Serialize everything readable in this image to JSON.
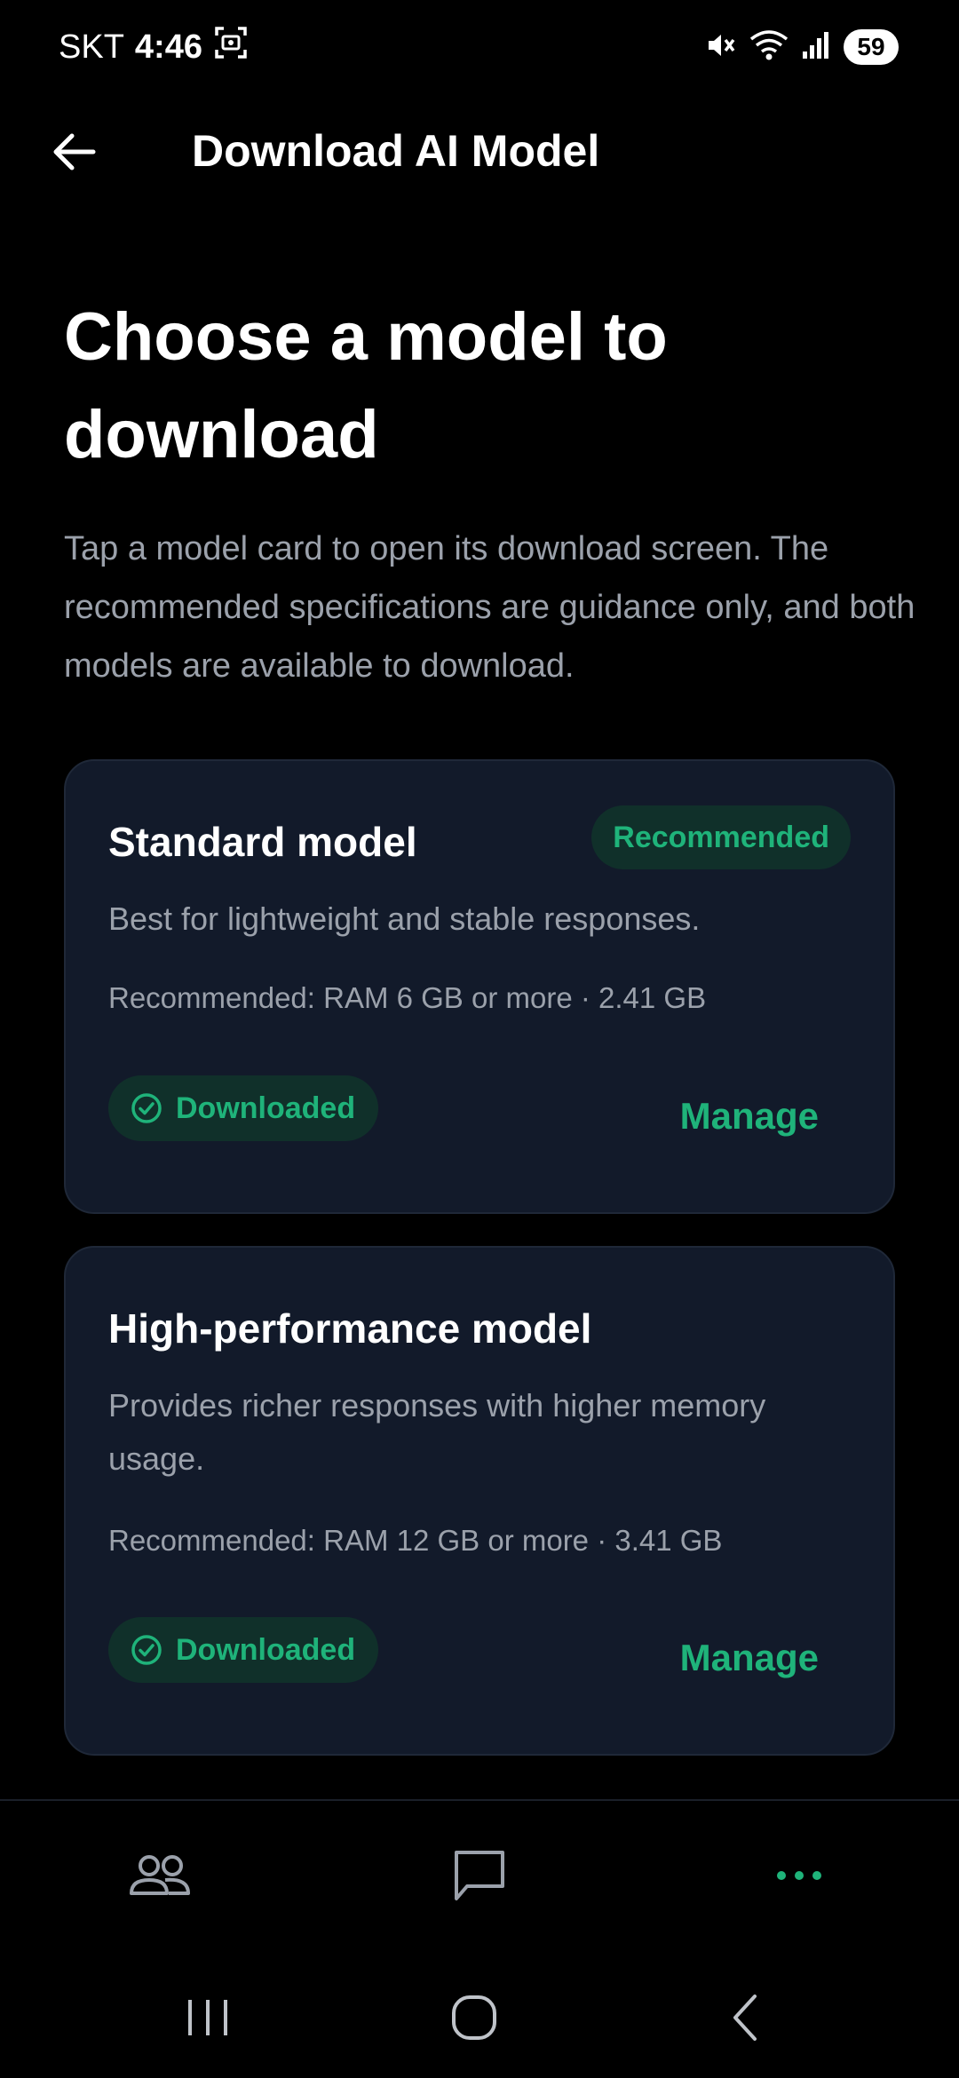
{
  "status_bar": {
    "carrier": "SKT",
    "time": "4:46",
    "battery": "59"
  },
  "app_bar": {
    "title": "Download AI Model",
    "back_icon": "arrow-left-icon"
  },
  "heading": "Choose a model to download",
  "intro": "Tap a model card to open its download screen. The recommended specifications are guidance only, and both models are available to download.",
  "models": [
    {
      "title": "Standard model",
      "badge": "Recommended",
      "description": "Best for lightweight and stable responses.",
      "spec": "Recommended: RAM 6 GB or more · 2.41 GB",
      "status": "Downloaded",
      "action": "Manage"
    },
    {
      "title": "High-performance model",
      "description": "Provides richer responses with higher memory usage.",
      "spec": "Recommended: RAM 12 GB or more · 3.41 GB",
      "status": "Downloaded",
      "action": "Manage"
    }
  ],
  "bottom_nav": {
    "items": [
      {
        "icon": "people-icon",
        "active": false
      },
      {
        "icon": "chat-bubble-icon",
        "active": false
      },
      {
        "icon": "more-dots-icon",
        "active": true
      }
    ]
  },
  "colors": {
    "background": "#000000",
    "card": "#121a2a",
    "accent": "#1fb37a",
    "muted_text": "#9ba1ab"
  }
}
